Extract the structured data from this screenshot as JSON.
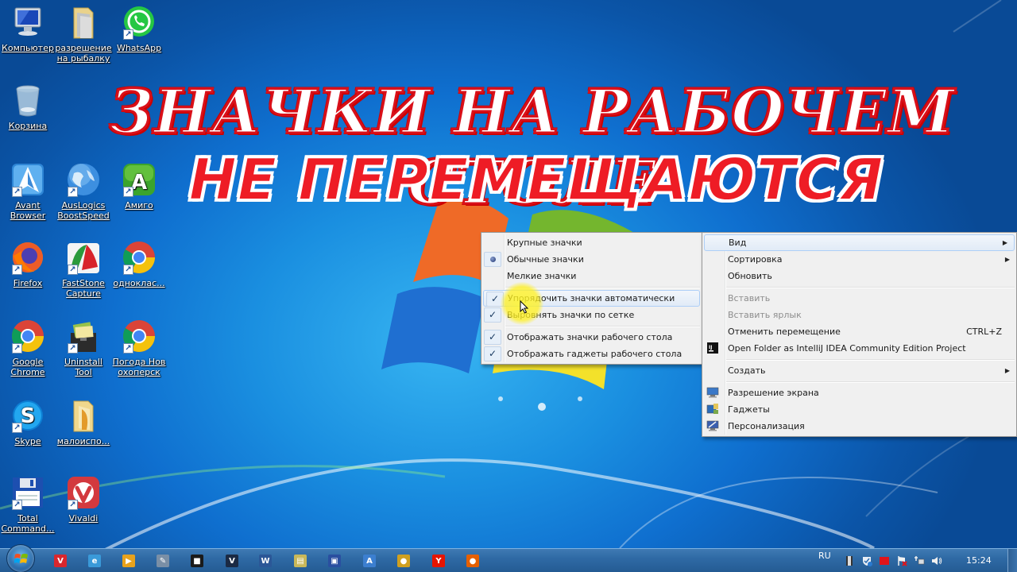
{
  "desktop": {
    "icons": [
      {
        "id": "computer",
        "label": "Компьютер",
        "icon": "computer-icon",
        "shortcut": false
      },
      {
        "id": "fishing-permit",
        "label": "разрешение на рыбалку",
        "icon": "folder-icon",
        "shortcut": false
      },
      {
        "id": "whatsapp",
        "label": "WhatsApp",
        "icon": "whatsapp-icon",
        "shortcut": true
      },
      {
        "id": "recycle-bin",
        "label": "Корзина",
        "icon": "recycle-bin-icon",
        "shortcut": false
      },
      {
        "id": "avant",
        "label": "Avant Browser",
        "icon": "avant-browser-icon",
        "shortcut": true
      },
      {
        "id": "auslogics",
        "label": "AusLogics BoostSpeed",
        "icon": "globe-icon",
        "shortcut": true
      },
      {
        "id": "amigo",
        "label": "Амиго",
        "icon": "amigo-icon",
        "shortcut": true
      },
      {
        "id": "firefox",
        "label": "Firefox",
        "icon": "firefox-icon",
        "shortcut": true
      },
      {
        "id": "faststone",
        "label": "FastStone Capture",
        "icon": "faststone-icon",
        "shortcut": true
      },
      {
        "id": "odnoklassniki",
        "label": "одноклас...",
        "icon": "chrome-icon",
        "shortcut": true
      },
      {
        "id": "google-chrome",
        "label": "Google Chrome",
        "icon": "chrome-icon",
        "shortcut": true
      },
      {
        "id": "uninstall-tool",
        "label": "Uninstall Tool",
        "icon": "uninstall-tool-icon",
        "shortcut": true
      },
      {
        "id": "weather",
        "label": "Погода Нов охоперск",
        "icon": "chrome-icon",
        "shortcut": true
      },
      {
        "id": "skype",
        "label": "Skype",
        "icon": "skype-icon",
        "shortcut": true
      },
      {
        "id": "rarely-used",
        "label": "малоиспо...",
        "icon": "folder-icon",
        "shortcut": false
      },
      {
        "id": "total-commander",
        "label": "Total Command...",
        "icon": "floppy-icon",
        "shortcut": true
      },
      {
        "id": "vivaldi",
        "label": "Vivaldi",
        "icon": "vivaldi-icon",
        "shortcut": true
      }
    ]
  },
  "headline": {
    "line1": "ЗНАЧКИ НА РАБОЧЕМ СТОЛЕ",
    "line2": "НЕ ПЕРЕМЕЩАЮТСЯ"
  },
  "context_menu": {
    "items": [
      {
        "label": "Вид",
        "submenu": true,
        "highlighted": true
      },
      {
        "label": "Сортировка",
        "submenu": true
      },
      {
        "label": "Обновить"
      },
      {
        "separator": true
      },
      {
        "label": "Вставить",
        "disabled": true
      },
      {
        "label": "Вставить ярлык",
        "disabled": true
      },
      {
        "label": "Отменить перемещение",
        "shortcut": "CTRL+Z"
      },
      {
        "label": "Open Folder as IntelliJ IDEA Community Edition Project",
        "icon": "intellij-icon"
      },
      {
        "separator": true
      },
      {
        "label": "Создать",
        "submenu": true
      },
      {
        "separator": true
      },
      {
        "label": "Разрешение экрана",
        "icon": "screen-resolution-icon"
      },
      {
        "label": "Гаджеты",
        "icon": "gadgets-icon"
      },
      {
        "label": "Персонализация",
        "icon": "personalization-icon"
      }
    ]
  },
  "view_submenu": {
    "items": [
      {
        "label": "Крупные значки",
        "state": "none"
      },
      {
        "label": "Обычные значки",
        "state": "radio"
      },
      {
        "label": "Мелкие значки",
        "state": "none"
      },
      {
        "separator": true
      },
      {
        "label": "Упорядочить значки автоматически",
        "state": "checked",
        "highlighted": true
      },
      {
        "label": "Выровнять значки по сетке",
        "state": "checked"
      },
      {
        "separator": true
      },
      {
        "label": "Отображать значки рабочего стола",
        "state": "checked"
      },
      {
        "label": "Отображать гаджеты  рабочего стола",
        "state": "checked"
      }
    ],
    "check_glyph": "✓"
  },
  "taskbar": {
    "pinned": [
      {
        "name": "vivaldi",
        "glyph": "V",
        "color": "#d9272e"
      },
      {
        "name": "internet-explorer",
        "glyph": "e",
        "color": "#3a9ad9"
      },
      {
        "name": "media-player",
        "glyph": "▶",
        "color": "#e8a21c"
      },
      {
        "name": "paint-tool",
        "glyph": "✎",
        "color": "#7a8fa6"
      },
      {
        "name": "terminal",
        "glyph": "■",
        "color": "#1a1a1a"
      },
      {
        "name": "app-v",
        "glyph": "V",
        "color": "#1b2a44"
      },
      {
        "name": "word",
        "glyph": "W",
        "color": "#2b5797"
      },
      {
        "name": "file-explorer",
        "glyph": "▤",
        "color": "#c9b85a"
      },
      {
        "name": "total-commander",
        "glyph": "▣",
        "color": "#2a4fa0"
      },
      {
        "name": "avant-browser",
        "glyph": "A",
        "color": "#3c7fd0"
      },
      {
        "name": "chrome",
        "glyph": "●",
        "color": "#d0a020"
      },
      {
        "name": "yandex-browser",
        "glyph": "Y",
        "color": "#e61400"
      },
      {
        "name": "firefox",
        "glyph": "●",
        "color": "#e66000"
      }
    ],
    "tray": {
      "language": "RU",
      "time": "15:24",
      "icons": [
        "film-icon",
        "security-shield-icon",
        "red-square-icon",
        "action-center-flag-icon",
        "network-icon",
        "volume-icon"
      ]
    }
  }
}
